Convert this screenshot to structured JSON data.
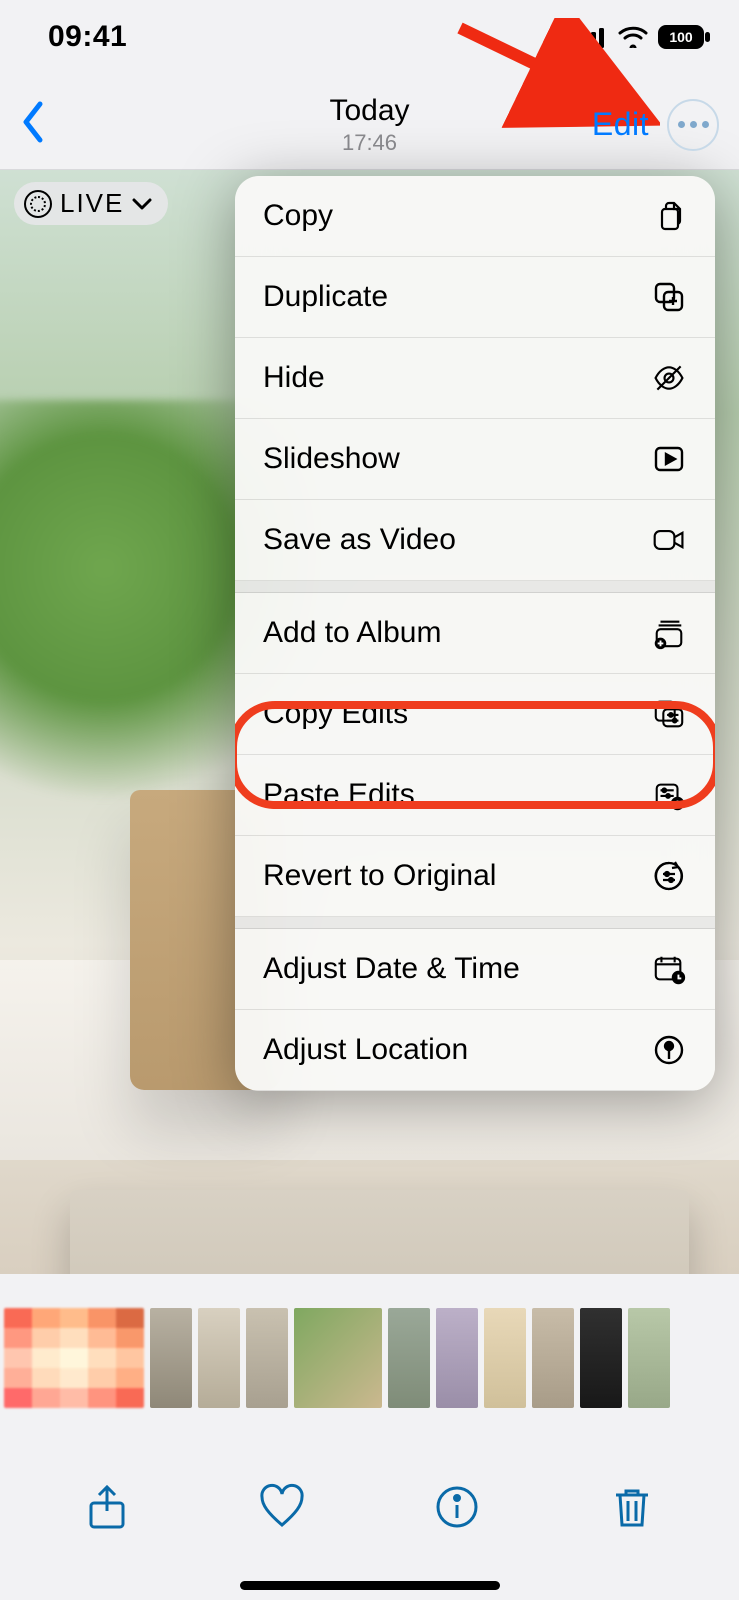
{
  "status": {
    "time": "09:41",
    "battery": "100"
  },
  "nav": {
    "title": "Today",
    "subtitle": "17:46",
    "edit_label": "Edit"
  },
  "live_badge": {
    "text": "LIVE"
  },
  "menu": {
    "items": [
      {
        "label": "Copy",
        "icon": "copy"
      },
      {
        "label": "Duplicate",
        "icon": "duplicate"
      },
      {
        "label": "Hide",
        "icon": "hide"
      },
      {
        "label": "Slideshow",
        "icon": "slideshow"
      },
      {
        "label": "Save as Video",
        "icon": "video"
      },
      {
        "label": "Add to Album",
        "icon": "album"
      },
      {
        "label": "Copy Edits",
        "icon": "copyedits"
      },
      {
        "label": "Paste Edits",
        "icon": "pasteedits"
      },
      {
        "label": "Revert to Original",
        "icon": "revert"
      },
      {
        "label": "Adjust Date & Time",
        "icon": "datetime"
      },
      {
        "label": "Adjust Location",
        "icon": "location"
      }
    ]
  },
  "annotations": {
    "arrow_target": "more-button",
    "highlighted_item": "Copy Edits"
  }
}
